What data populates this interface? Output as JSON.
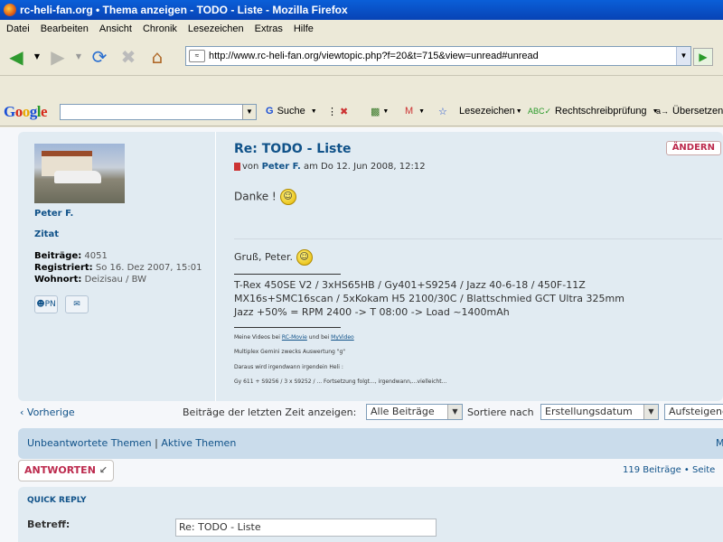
{
  "window": {
    "title": "rc-heli-fan.org • Thema anzeigen - TODO - Liste - Mozilla Firefox"
  },
  "menu": [
    "Datei",
    "Bearbeiten",
    "Ansicht",
    "Chronik",
    "Lesezeichen",
    "Extras",
    "Hilfe"
  ],
  "address": {
    "url": "http://www.rc-heli-fan.org/viewtopic.php?f=20&t=715&view=unread#unread"
  },
  "google_toolbar": {
    "logo": "Google",
    "search_value": "",
    "suche": "Suche",
    "lesezeichen": "Lesezeichen",
    "rechtschreib": "Rechtschreibprüfung",
    "uebersetzen": "Übersetzen"
  },
  "post": {
    "author": "Peter F.",
    "zitat": "Zitat",
    "stats": {
      "beitraege_label": "Beiträge:",
      "beitraege": "4051",
      "registriert_label": "Registriert:",
      "registriert": "So 16. Dez 2007, 15:01",
      "wohnort_label": "Wohnort:",
      "wohnort": "Deizisau / BW"
    },
    "pm_label": "PN",
    "title": "Re: TODO - Liste",
    "meta_von": "von",
    "meta_date": "am Do 12. Jun 2008, 12:12",
    "edit_label": "ÄNDERN",
    "text": "Danke !",
    "gruss": "Gruß, Peter.",
    "sig_lines": [
      "T-Rex 450SE V2 / 3xHS65HB / Gy401+S9254 / Jazz 40-6-18 / 450F-11Z",
      "MX16s+SMC16scan / 5xKokam H5 2100/30C / Blattschmied GCT Ultra 325mm",
      "Jazz +50% = RPM 2400 -> T 08:00 -> Load ~1400mAh"
    ],
    "tiny1_pre": "Meine Videos bei ",
    "tiny1_link1": "RC-Movie",
    "tiny1_mid": " und bei ",
    "tiny1_link2": "MyVideo",
    "tiny2": "Multiplex Gemini zwecks Auswertung \"g\"",
    "tiny3": "Daraus wird irgendwann irgendein Heli :",
    "tiny4": "Gy 611 + S9256 / 3 x S9252 / ... Fortsetzung folgt..., irgendwann,...vielleicht..."
  },
  "pagination": {
    "prev": "Vorherige",
    "show_label": "Beiträge der letzten Zeit anzeigen:",
    "show_value": "Alle Beiträge",
    "sort_label": "Sortiere nach",
    "sort_value": "Erstellungsdatum",
    "order_value": "Aufsteigend"
  },
  "nav": {
    "unanswered": "Unbeantwortete Themen",
    "sep": "|",
    "active": "Aktive Themen",
    "right": "M"
  },
  "answer_label": "ANTWORTEN",
  "post_count": "119 Beiträge • Seite",
  "quick_reply": {
    "heading": "QUICK REPLY",
    "betreff_label": "Betreff:",
    "betreff_value": "Re: TODO - Liste"
  }
}
